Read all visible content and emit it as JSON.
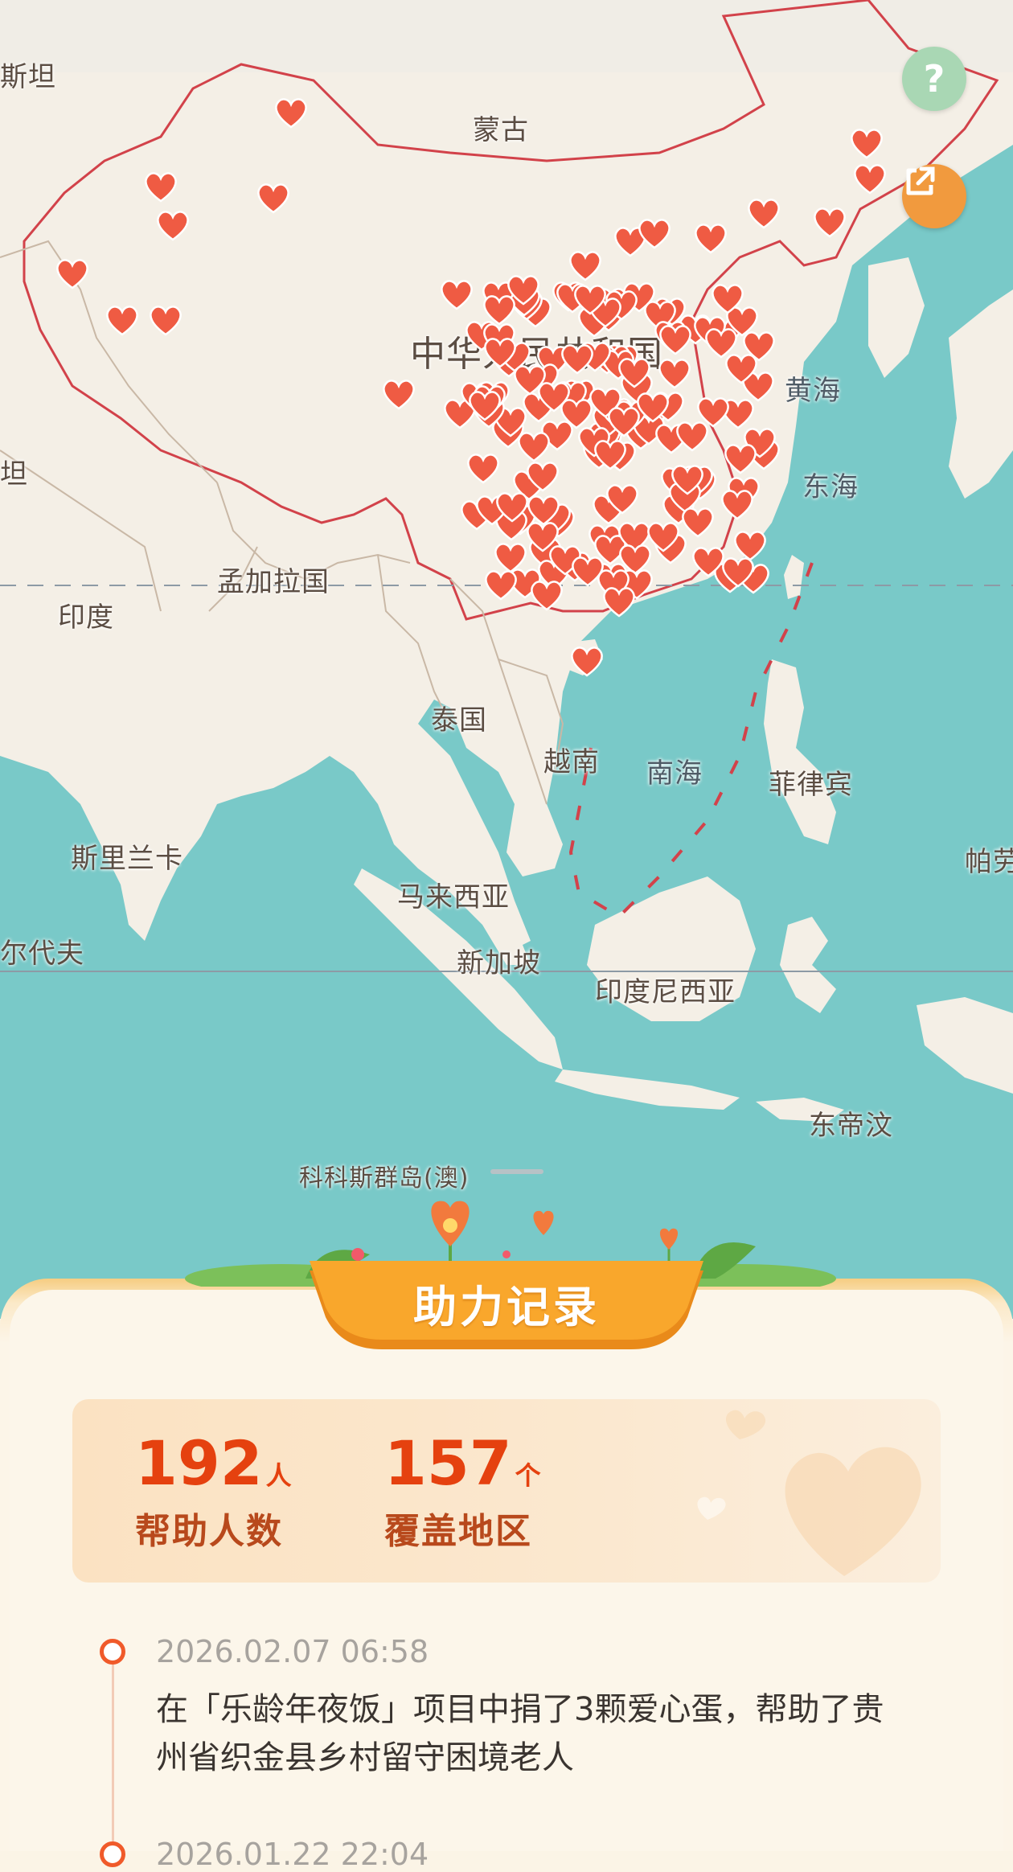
{
  "map": {
    "labels": {
      "pakistan_partial": "斯坦",
      "mongolia": "蒙古",
      "china": "中华人民共和国",
      "yellow_sea": "黄海",
      "east_sea": "东海",
      "bangladesh": "孟加拉国",
      "india": "印度",
      "thailand": "泰国",
      "vietnam": "越南",
      "south_sea": "南海",
      "philippines": "菲律宾",
      "sri_lanka": "斯里兰卡",
      "malaysia": "马来西亚",
      "maldives_partial": "尔代夫",
      "singapore": "新加坡",
      "indonesia": "印度尼西亚",
      "palau_partial": "帕劳",
      "east_timor": "东帝汶",
      "cocos_islands": "科科斯群岛(澳)",
      "left_edge_partial": "坦"
    },
    "heart_color": "#ef5b43",
    "water_color": "#79c9c8",
    "land_color": "#f4efe6"
  },
  "controls": {
    "help_icon_glyph": "?",
    "help_icon": "question-icon",
    "share_icon": "external-link-icon"
  },
  "panel": {
    "title": "助力记录",
    "stats": {
      "helped_count": "192",
      "helped_unit": "人",
      "helped_label": "帮助人数",
      "region_count": "157",
      "region_unit": "个",
      "region_label": "覆盖地区"
    },
    "records": [
      {
        "time": "2026.02.07 06:58",
        "text": "在「乐龄年夜饭」项目中捐了3颗爱心蛋，帮助了贵州省织金县乡村留守困境老人"
      },
      {
        "time": "2026.01.22 22:04",
        "text": ""
      }
    ],
    "accent_color": "#e5410f"
  }
}
